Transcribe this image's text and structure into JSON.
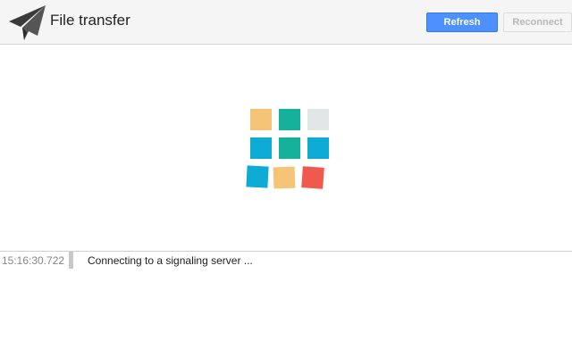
{
  "header": {
    "title": "File transfer",
    "logo_icon": "paper-plane-icon",
    "refresh_label": "Refresh",
    "reconnect_label": "Reconnect"
  },
  "loader": {
    "icon": "tile-grid-loading-icon",
    "tile_colors": [
      "#f6c476",
      "#16b19b",
      "#e1e6e6",
      "#0eacd4",
      "#f05a4e"
    ]
  },
  "log": {
    "entries": [
      {
        "time": "15:16:30.722",
        "message": "Connecting to a signaling server ..."
      }
    ]
  }
}
